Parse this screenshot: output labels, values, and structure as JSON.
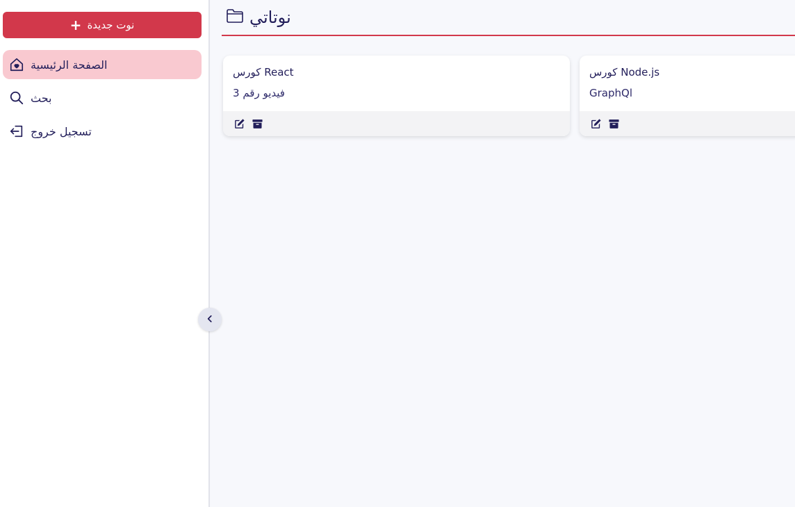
{
  "sidebar": {
    "new_note_label": "نوت جديدة",
    "new_note_icon": "plus-icon",
    "items": [
      {
        "label": "الصفحة الرئيسية",
        "icon": "home-heart-icon",
        "active": true
      },
      {
        "label": "بحث",
        "icon": "search-icon",
        "active": false
      },
      {
        "label": "تسجيل خروج",
        "icon": "logout-icon",
        "active": false
      }
    ],
    "collapse_icon": "chevron-left-icon"
  },
  "header": {
    "title": "نوتاتي",
    "icon": "folder-icon"
  },
  "notes": [
    {
      "title": "كورس React",
      "body": "فيديو رقم 3",
      "actions": [
        "edit-icon",
        "archive-icon"
      ]
    },
    {
      "title": "كورس Node.js",
      "body": "GraphQl",
      "actions": [
        "edit-icon",
        "archive-icon"
      ]
    }
  ],
  "colors": {
    "accent": "#d2384b",
    "active_bg": "#f9c9d0",
    "text": "#221e5a",
    "background": "#f7f8fc"
  }
}
